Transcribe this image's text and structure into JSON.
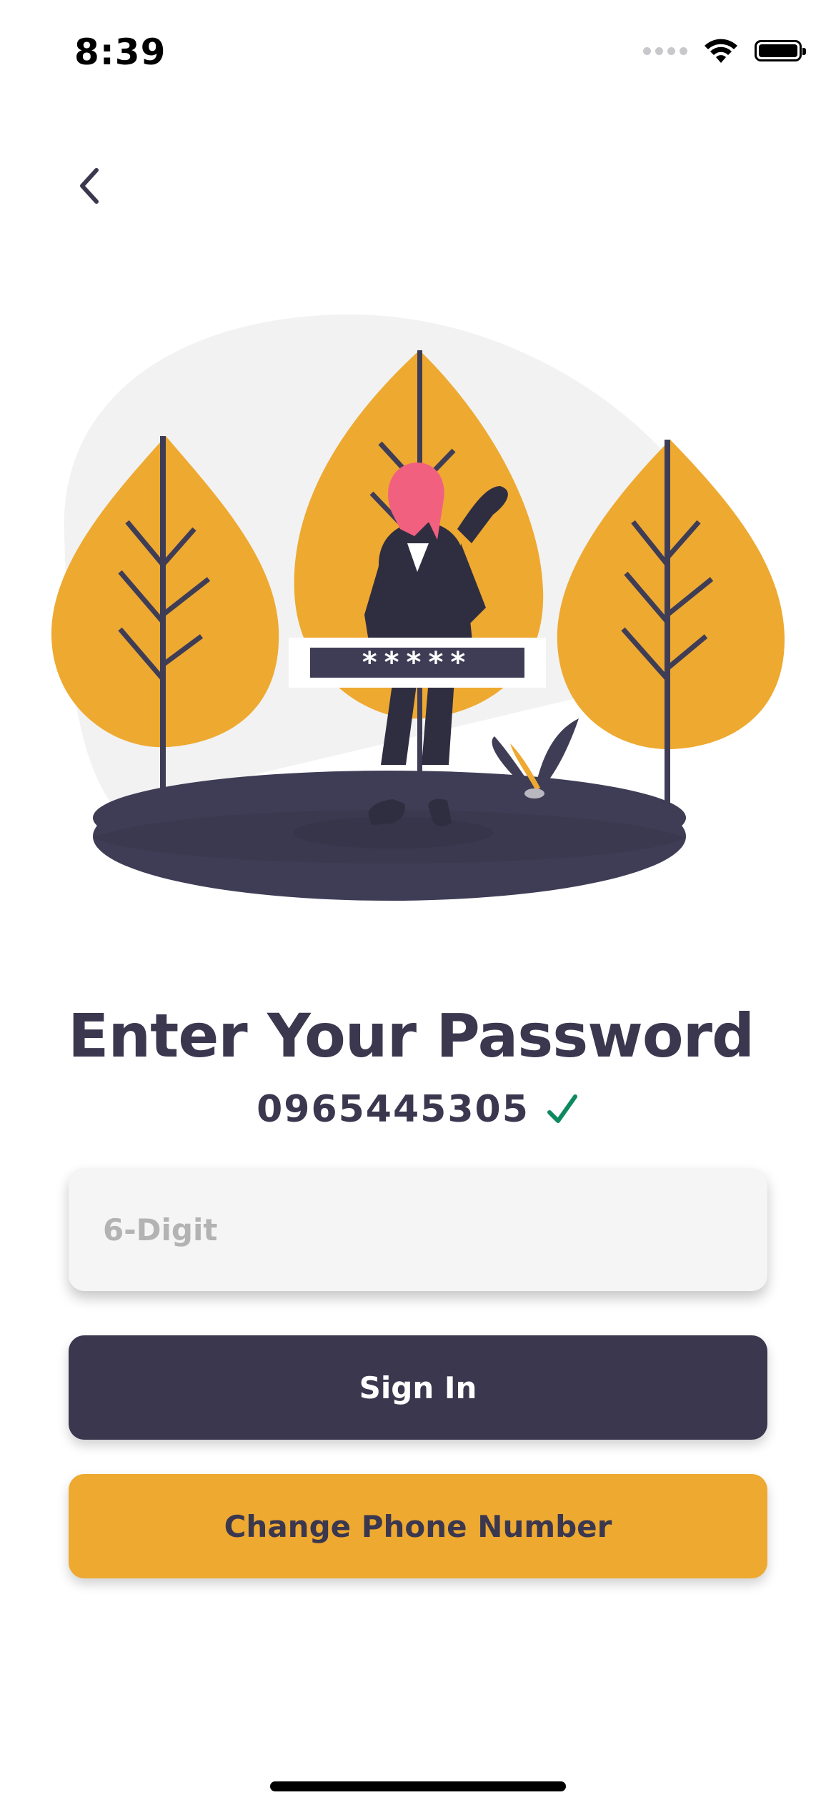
{
  "status_bar": {
    "time": "8:39"
  },
  "screen": {
    "title": "Enter Your Password",
    "phone_number": "0965445305",
    "password_placeholder": "6-Digit",
    "password_mask": "*****",
    "sign_in_label": "Sign In",
    "change_phone_label": "Change Phone Number"
  },
  "colors": {
    "primary": "#3a374f",
    "accent": "#eea931",
    "verified": "#0e8a5f",
    "input_bg": "#f5f5f5"
  },
  "icons": [
    "signal-icon",
    "wifi-icon",
    "battery-icon",
    "back-chevron-icon",
    "verified-check-icon"
  ]
}
